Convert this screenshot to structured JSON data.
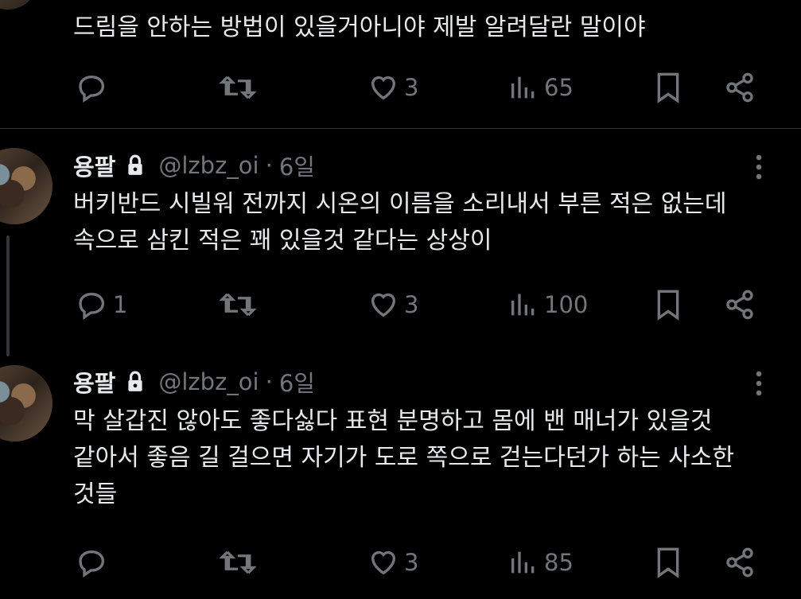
{
  "tweets": [
    {
      "text": "드림을 안하는 방법이 있을거아니야 제발 알려달란 말이야",
      "actions": {
        "reply": "",
        "retweet": "",
        "like": "3",
        "views": "65"
      }
    },
    {
      "name": "용팔",
      "handle": "@lzbz_oi",
      "separator": "·",
      "time": "6일",
      "text": "버키반드 시빌워 전까지 시온의 이름을 소리내서 부른 적은 없는데\n속으로 삼킨 적은 꽤 있을것 같다는 상상이",
      "actions": {
        "reply": "1",
        "retweet": "",
        "like": "3",
        "views": "100"
      }
    },
    {
      "name": "용팔",
      "handle": "@lzbz_oi",
      "separator": "·",
      "time": "6일",
      "text": "막 살갑진 않아도 좋다싫다 표현 분명하고 몸에 밴 매너가 있을것\n같아서 좋음 길 걸으면 자기가 도로 쪽으로 걷는다던가 하는 사소한\n것들",
      "actions": {
        "reply": "",
        "retweet": "",
        "like": "3",
        "views": "85"
      }
    }
  ],
  "icons": [
    "reply-icon",
    "retweet-icon",
    "like-icon",
    "views-icon",
    "bookmark-icon",
    "share-icon",
    "lock-icon",
    "more-icon"
  ],
  "colors": {
    "background": "#000000",
    "text": "#e7e9ea",
    "secondary": "#71767b",
    "divider": "#2f3336"
  }
}
